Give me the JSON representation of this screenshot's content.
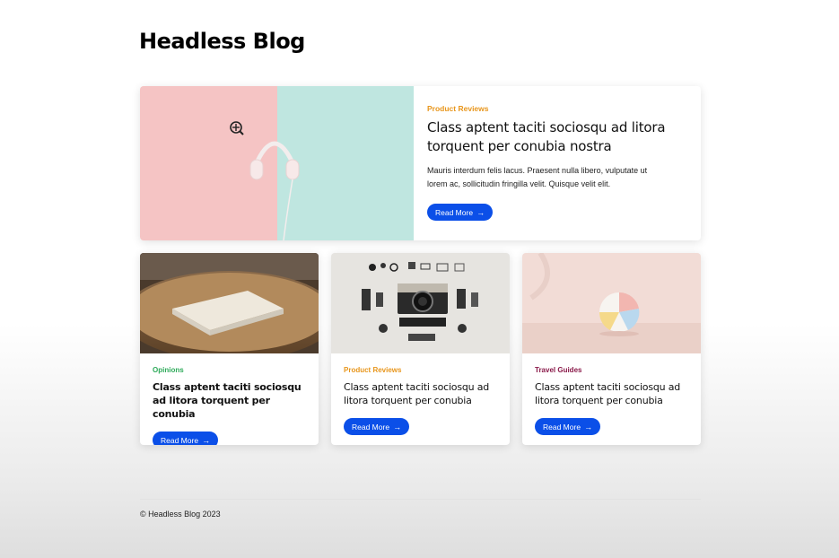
{
  "site": {
    "title": "Headless Blog"
  },
  "featured": {
    "category": "Product Reviews",
    "category_color": "#e8961c",
    "title": "Class aptent taciti sociosqu ad litora torquent per conubia nostra",
    "excerpt": "Mauris interdum felis lacus. Praesent nulla libero, vulputate ut lorem ac, sollicitudin fringilla velit. Quisque velit elit.",
    "button_label": "Read More",
    "image_icon": "headphones-image"
  },
  "cards": [
    {
      "category": "Opinions",
      "category_color": "#2eaa5a",
      "title": "Class aptent taciti sociosqu ad litora torquent per conubia",
      "button_label": "Read More",
      "image_icon": "book-on-table-image"
    },
    {
      "category": "Product Reviews",
      "category_color": "#e8961c",
      "title": "Class aptent taciti sociosqu ad litora torquent per conubia",
      "button_label": "Read More",
      "image_icon": "camera-flatlay-image"
    },
    {
      "category": "Travel Guides",
      "category_color": "#8a1a4a",
      "title": "Class aptent taciti sociosqu ad litora torquent per conubia",
      "button_label": "Read More",
      "image_icon": "beach-ball-image"
    }
  ],
  "footer": {
    "copyright": "© Headless Blog 2023"
  },
  "colors": {
    "accent": "#0b4fe8"
  }
}
